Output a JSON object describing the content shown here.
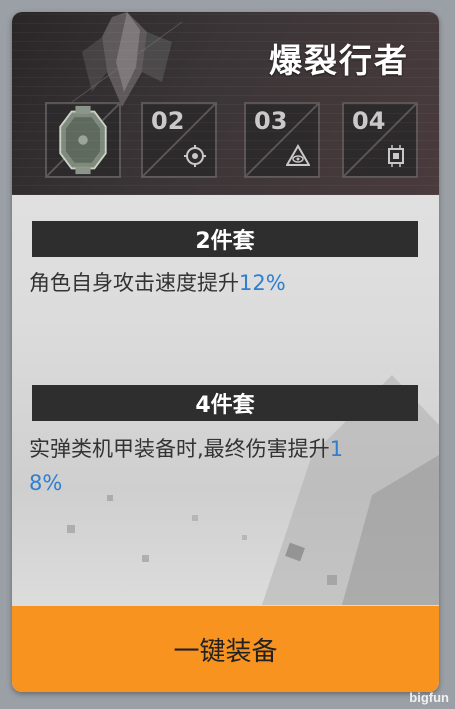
{
  "set": {
    "title": "爆裂行者"
  },
  "slots": [
    {
      "label": "",
      "icon": "armor-plate-icon",
      "selected": true
    },
    {
      "label": "02",
      "icon": "gear-core-icon"
    },
    {
      "label": "03",
      "icon": "eye-triangle-icon"
    },
    {
      "label": "04",
      "icon": "chip-icon"
    }
  ],
  "bonuses": [
    {
      "title": "2件套",
      "text": "角色自身攻击速度提升",
      "value": "12%"
    },
    {
      "title": "4件套",
      "text": "实弹类机甲装备时,最终伤害提升",
      "value_part1": "1",
      "value_part2": "8%"
    }
  ],
  "action": {
    "equip_label": "一键装备"
  },
  "watermark": "bigfun",
  "colors": {
    "accent": "#f7931e",
    "highlight": "#2f7fd1",
    "bar": "#2e2e2e",
    "header": "#2a2627"
  }
}
